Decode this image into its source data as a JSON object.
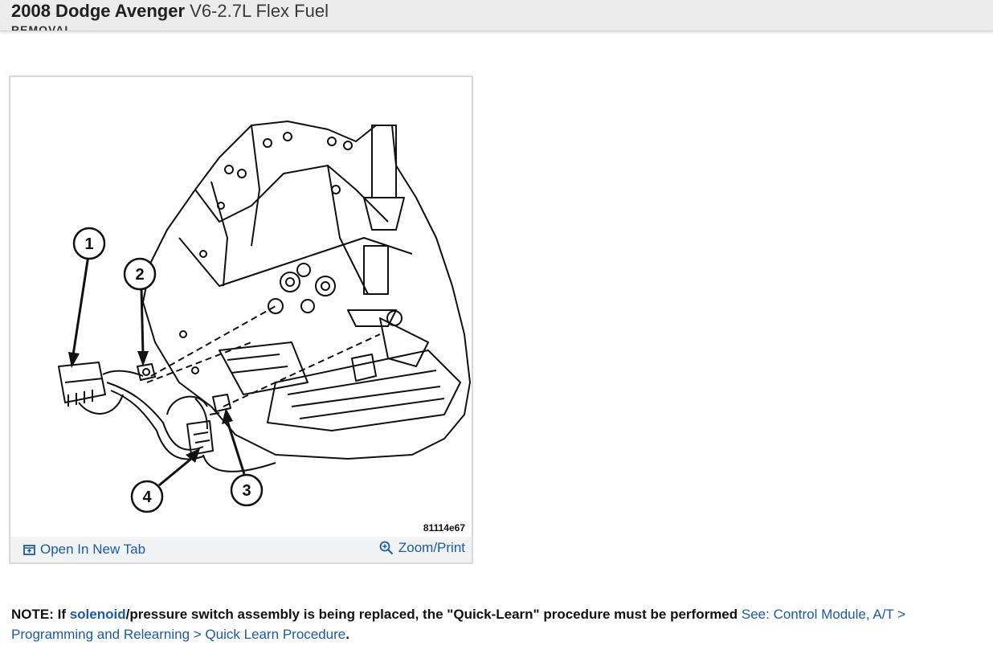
{
  "header": {
    "vehicle": "2008 Dodge Avenger",
    "engine": "V6-2.7L Flex Fuel",
    "partial_heading": "REMOVAL"
  },
  "figure": {
    "callouts": [
      "1",
      "2",
      "3",
      "4"
    ],
    "figure_id": "81114e67",
    "open_new_tab_label": "Open In New Tab",
    "zoom_print_label": "Zoom/Print",
    "open_icon": "open-in-new-tab-icon",
    "zoom_icon": "zoom-in-icon"
  },
  "note": {
    "prefix": "NOTE: If ",
    "solenoid_link": "solenoid",
    "body": "/pressure switch assembly is being replaced, the \"Quick-Learn\" procedure must be performed",
    "see_link": " See: Control Module, A/T > Programming and Relearning > Quick Learn Procedure",
    "suffix": "."
  },
  "colors": {
    "link": "#1a5aa6",
    "header_bg": "#ececec",
    "figure_bar_bg": "#f1f2f4"
  }
}
